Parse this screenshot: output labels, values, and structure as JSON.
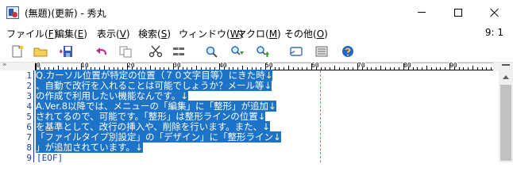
{
  "window": {
    "title": "(無題)(更新) - 秀丸"
  },
  "menu": {
    "items": [
      {
        "label": "ファイル(F)"
      },
      {
        "label": "編集(E)"
      },
      {
        "label": "表示(V)"
      },
      {
        "label": "検索(S)"
      },
      {
        "label": "ウィンドウ(W)"
      },
      {
        "label": "マクロ(M)"
      },
      {
        "label": "その他(O)"
      }
    ],
    "cursor_position": "9: 1"
  },
  "toolbar": {
    "icons": [
      "new-file-icon",
      "open-folder-icon",
      "save-icon",
      "undo-icon",
      "copy-icon",
      "cut-icon",
      "paste-icon",
      "search-icon",
      "find-next-down-icon",
      "find-prev-up-icon",
      "grep-icon",
      "macro-icon",
      "help-icon"
    ]
  },
  "ruler": {
    "labels": [
      "0",
      "10",
      "20",
      "30",
      "40",
      "50",
      "60",
      "70",
      "80",
      "90"
    ]
  },
  "editor": {
    "line_numbers": [
      "1",
      "2",
      "3",
      "4",
      "5",
      "6",
      "7",
      "8",
      "9"
    ],
    "lines": [
      "Q.カーソル位置が特定の位置（７０文字目等）にきた時",
      "、自動で改行を入れることは可能でしょうか？メール等",
      "の作成で利用したい機能なんです。",
      "A.Ver.8以降では、メニューの「編集」に「整形」が追加",
      "されてるので、可能です。「整形」は整形ラインの位置",
      "を基準として、改行の挿入や、削除を行います。また、",
      "「ファイルタイプ別設定」の「デザイン」に「整形ライン",
      "」が追加されています。"
    ],
    "newline_marker": "↓",
    "eof_marker": "[EOF]"
  }
}
